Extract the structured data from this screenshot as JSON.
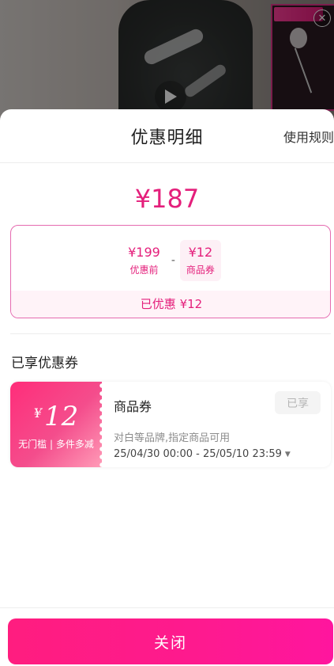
{
  "sheet": {
    "title": "优惠明细",
    "rules_link": "使用规则",
    "final_price": "¥187"
  },
  "calculation": {
    "original_amount": "¥199",
    "original_label": "优惠前",
    "operator": "-",
    "coupon_amount": "¥12",
    "coupon_label": "商品券",
    "summary": "已优惠 ¥12"
  },
  "coupons_section": {
    "title": "已享优惠券",
    "items": [
      {
        "currency": "¥",
        "amount": "12",
        "condition": "无门槛 | 多件多减",
        "name": "商品券",
        "description": "对白等品牌,指定商品可用",
        "validity": "25/04/30 00:00 - 25/05/10 23:59",
        "status": "已享"
      }
    ]
  },
  "footer": {
    "close_label": "关闭"
  },
  "colors": {
    "accent": "#e41f7b",
    "button": "#ff1d7f"
  }
}
